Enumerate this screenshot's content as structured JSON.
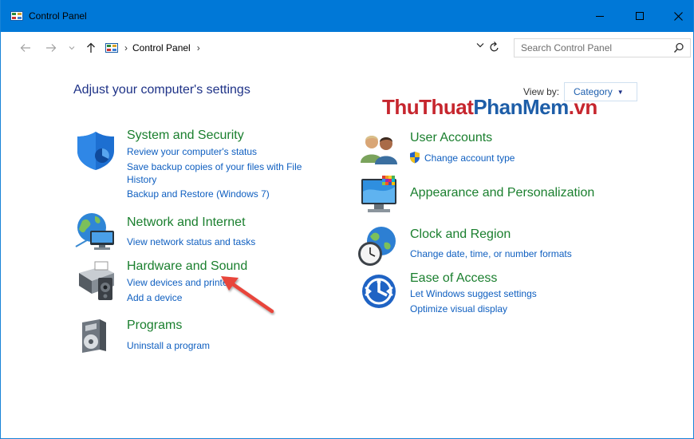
{
  "window": {
    "title": "Control Panel"
  },
  "addressbar": {
    "breadcrumb_root": "Control Panel",
    "search_placeholder": "Search Control Panel"
  },
  "main": {
    "heading": "Adjust your computer's settings",
    "view_by_label": "View by:",
    "view_by_value": "Category"
  },
  "watermark": {
    "part1": "ThuThuat",
    "part2": "PhanMem",
    "part3": ".vn"
  },
  "categories": {
    "system_security": {
      "title": "System and Security",
      "links": [
        "Review your computer's status",
        "Save backup copies of your files with File",
        "History",
        "Backup and Restore (Windows 7)"
      ]
    },
    "network": {
      "title": "Network and Internet",
      "links": [
        "View network status and tasks"
      ]
    },
    "hardware": {
      "title": "Hardware and Sound",
      "links": [
        "View devices and printers",
        "Add a device"
      ]
    },
    "programs": {
      "title": "Programs",
      "links": [
        "Uninstall a program"
      ]
    },
    "user_accounts": {
      "title": "User Accounts",
      "links": [
        "Change account type"
      ]
    },
    "appearance": {
      "title": "Appearance and Personalization"
    },
    "clock": {
      "title": "Clock and Region",
      "links": [
        "Change date, time, or number formats"
      ]
    },
    "ease": {
      "title": "Ease of Access",
      "links": [
        "Let Windows suggest settings",
        "Optimize visual display"
      ]
    }
  },
  "colors": {
    "titlebar": "#0078d7",
    "category_title": "#1a7f2e",
    "link": "#0f5fc0",
    "heading": "#1e3287",
    "annotation_arrow": "#e8443a"
  },
  "icons": [
    "control-panel-icon",
    "minimize-icon",
    "maximize-icon",
    "close-icon",
    "back-arrow-icon",
    "forward-arrow-icon",
    "recent-chevron-icon",
    "up-arrow-icon",
    "chevron-down-icon",
    "refresh-icon",
    "search-icon",
    "shield-icon",
    "globe-network-icon",
    "printer-icon",
    "programs-icon",
    "users-icon",
    "uac-shield-icon",
    "monitor-icon",
    "clock-globe-icon",
    "ease-of-access-icon",
    "annotation-arrow"
  ]
}
